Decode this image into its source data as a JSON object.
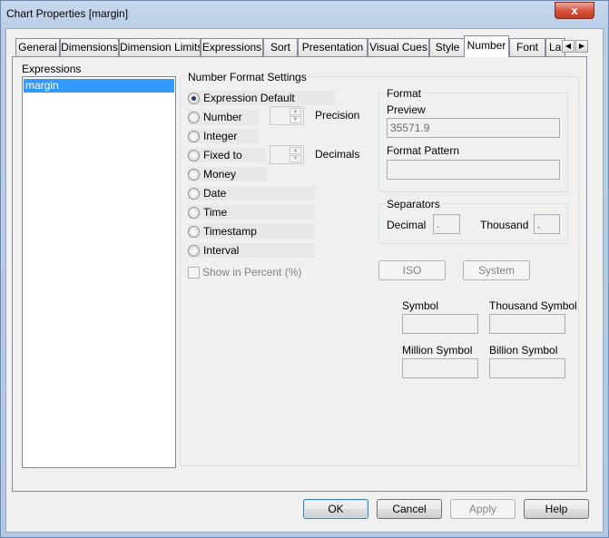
{
  "window": {
    "title": "Chart Properties [margin]",
    "close_glyph": "x"
  },
  "tabs": [
    {
      "label": "General"
    },
    {
      "label": "Dimensions"
    },
    {
      "label": "Dimension Limits"
    },
    {
      "label": "Expressions"
    },
    {
      "label": "Sort"
    },
    {
      "label": "Presentation"
    },
    {
      "label": "Visual Cues"
    },
    {
      "label": "Style"
    },
    {
      "label": "Number"
    },
    {
      "label": "Font"
    },
    {
      "label": "La"
    }
  ],
  "active_tab": "Number",
  "expressions": {
    "label": "Expressions",
    "items": [
      "margin"
    ]
  },
  "number_format": {
    "group_title": "Number Format Settings",
    "options": [
      {
        "label": "Expression Default",
        "checked": true
      },
      {
        "label": "Number",
        "checked": false
      },
      {
        "label": "Integer",
        "checked": false
      },
      {
        "label": "Fixed to",
        "checked": false
      },
      {
        "label": "Money",
        "checked": false
      },
      {
        "label": "Date",
        "checked": false
      },
      {
        "label": "Time",
        "checked": false
      },
      {
        "label": "Timestamp",
        "checked": false
      },
      {
        "label": "Interval",
        "checked": false
      }
    ],
    "precision_label": "Precision",
    "decimals_label": "Decimals",
    "show_in_percent": "Show in Percent (%)"
  },
  "format": {
    "group_title": "Format",
    "preview_label": "Preview",
    "preview_value": "35571.9",
    "pattern_label": "Format Pattern",
    "pattern_value": ""
  },
  "separators": {
    "group_title": "Separators",
    "decimal_label": "Decimal",
    "decimal_value": ".",
    "thousand_label": "Thousand",
    "thousand_value": ","
  },
  "buttons_mid": {
    "iso": "ISO",
    "system": "System"
  },
  "symbols": {
    "symbol": "Symbol",
    "thousand_symbol": "Thousand Symbol",
    "million_symbol": "Million Symbol",
    "billion_symbol": "Billion Symbol"
  },
  "footer": {
    "ok": "OK",
    "cancel": "Cancel",
    "apply": "Apply",
    "help": "Help"
  }
}
